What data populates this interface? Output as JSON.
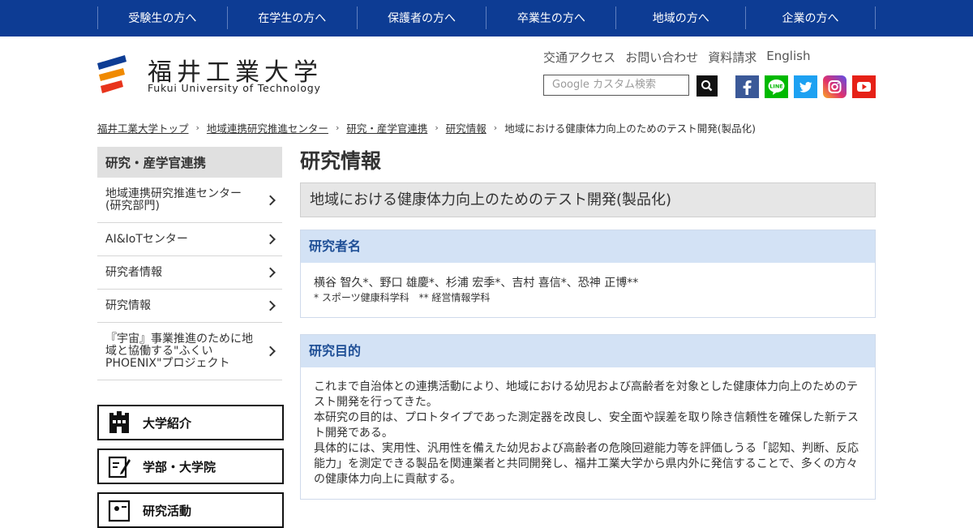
{
  "topnav": {
    "items": [
      "受験生の方へ",
      "在学生の方へ",
      "保護者の方へ",
      "卒業生の方へ",
      "地域の方へ",
      "企業の方へ"
    ]
  },
  "header": {
    "logo_title": "福井工業大学",
    "logo_sub": "Fukui University of Technology",
    "util_links": [
      "交通アクセス",
      "お問い合わせ",
      "資料請求",
      "English"
    ],
    "search_placeholder": "Google カスタム検索",
    "social": [
      "facebook-icon",
      "line-icon",
      "twitter-icon",
      "instagram-icon",
      "youtube-icon"
    ]
  },
  "breadcrumb": {
    "items": [
      "福井工業大学トップ",
      "地域連携研究推進センター",
      "研究・産学官連携",
      "研究情報"
    ],
    "current": "地域における健康体力向上のためのテスト開発(製品化)"
  },
  "sidebar": {
    "heading": "研究・産学官連携",
    "items": [
      {
        "label": "地域連携研究推進センター\n(研究部門)"
      },
      {
        "label": "AI&IoTセンター"
      },
      {
        "label": "研究者情報"
      },
      {
        "label": "研究情報"
      },
      {
        "label": "『宇宙』事業推進のために地域と協働する\"ふくいPHOENIX\"プロジェクト"
      }
    ],
    "buttons": [
      "大学紹介",
      "学部・大学院",
      "研究活動"
    ]
  },
  "main": {
    "title": "研究情報",
    "subtitle": "地域における健康体力向上のためのテスト開発(製品化)",
    "researchers": {
      "heading": "研究者名",
      "names": "横谷 智久*、野口 雄慶*、杉浦 宏季*、吉村 喜信*、恐神 正博**",
      "affiliations": "* スポーツ健康科学科　** 経営情報学科"
    },
    "purpose": {
      "heading": "研究目的",
      "text": "これまで自治体との連携活動により、地域における幼児および高齢者を対象とした健康体力向上のためのテスト開発を行ってきた。\n本研究の目的は、プロトタイプであった測定器を改良し、安全面や誤差を取り除き信頼性を確保した新テスト開発である。\n具体的には、実用性、汎用性を備えた幼児および高齢者の危険回避能力等を評価しうる「認知、判断、反応能力」を測定できる製品を関連業者と共同開発し、福井工業大学から県内外に発信することで、多くの方々の健康体力向上に貢献する。"
    }
  },
  "colors": {
    "nav_bg": "#0d3c94",
    "box_head_bg": "#d3e2f5",
    "box_head_text": "#1f4f96"
  }
}
